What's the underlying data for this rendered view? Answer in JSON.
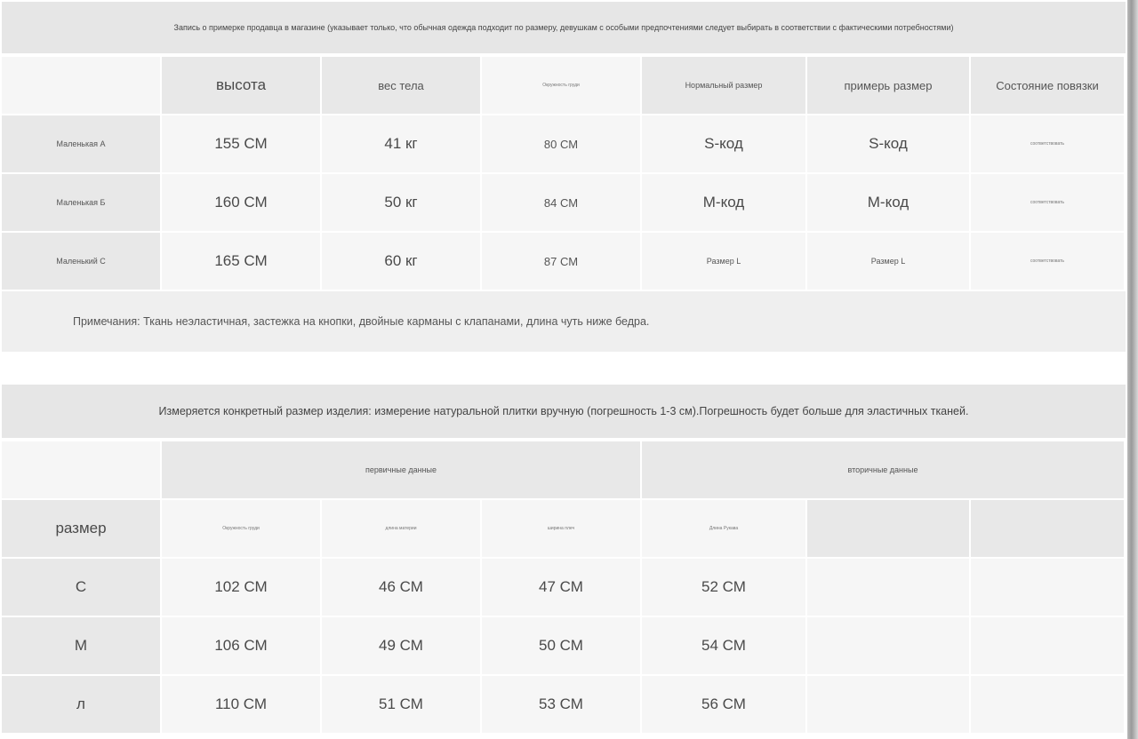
{
  "fitting_table": {
    "title": "Запись о примерке продавца в магазине (указывает только, что обычная одежда подходит по размеру, девушкам с особыми предпочтениями следует выбирать в соответствии с фактическими потребностями)",
    "headers": [
      "",
      "высота",
      "вес тела",
      "Окружность груди",
      "Нормальный размер",
      "примерь размер",
      "Состояние повязки"
    ],
    "rows": [
      {
        "name": "Маленькая А",
        "height": "155 СМ",
        "weight": "41 кг",
        "bust": "80 СМ",
        "normal": "S-код",
        "tried": "S-код",
        "status": "соответствовать"
      },
      {
        "name": "Маленькая Б",
        "height": "160 СМ",
        "weight": "50 кг",
        "bust": "84 СМ",
        "normal": "М-код",
        "tried": "М-код",
        "status": "соответствовать"
      },
      {
        "name": "Маленький С",
        "height": "165 СМ",
        "weight": "60 кг",
        "bust": "87 СМ",
        "normal": "Размер L",
        "tried": "Размер L",
        "status": "соответствовать"
      }
    ],
    "note": "Примечания: Ткань неэластичная, застежка на кнопки, двойные карманы с клапанами, длина чуть ниже бедра."
  },
  "measure_table": {
    "title": "Измеряется конкретный размер изделия: измерение натуральной плитки вручную (погрешность 1-3 см).Погрешность будет больше для эластичных тканей.",
    "group_primary": "первичные данные",
    "group_secondary": "вторичные данные",
    "headers": [
      "размер",
      "Окружность груди",
      "длина материи",
      "ширина плеч",
      "Длина Рукава",
      "",
      ""
    ],
    "rows": [
      {
        "size": "С",
        "bust": "102 СМ",
        "length": "46 СМ",
        "shoulder": "47 СМ",
        "sleeve": "52 СМ"
      },
      {
        "size": "М",
        "bust": "106 СМ",
        "length": "49 СМ",
        "shoulder": "50 СМ",
        "sleeve": "54 СМ"
      },
      {
        "size": "л",
        "bust": "110 СМ",
        "length": "51 СМ",
        "shoulder": "53 СМ",
        "sleeve": "56 СМ"
      }
    ]
  }
}
